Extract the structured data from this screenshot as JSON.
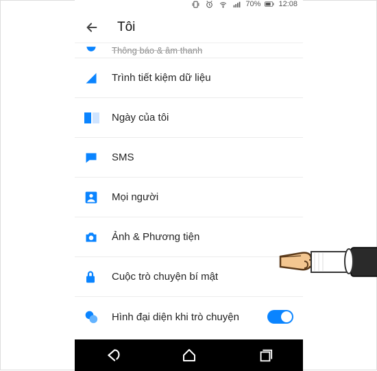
{
  "statusbar": {
    "battery_pct": "70%",
    "time": "12:08"
  },
  "header": {
    "title": "Tôi"
  },
  "rows": {
    "notif": {
      "label": "Thông báo & âm thanh"
    },
    "datasaver": {
      "label": "Trình tiết kiệm dữ liệu"
    },
    "myday": {
      "label": "Ngày của tôi"
    },
    "sms": {
      "label": "SMS"
    },
    "people": {
      "label": "Mọi người"
    },
    "media": {
      "label": "Ảnh & Phương tiện"
    },
    "secret": {
      "label": "Cuộc trò chuyện bí mật"
    },
    "avatar": {
      "label": "Hình đại diện khi trò chuyện",
      "toggle": true
    }
  },
  "colors": {
    "accent": "#0a84ff"
  }
}
